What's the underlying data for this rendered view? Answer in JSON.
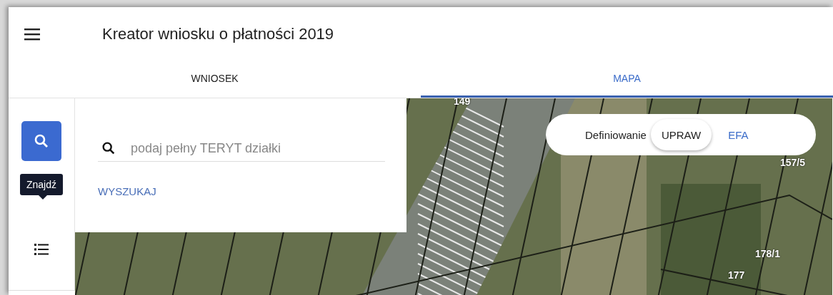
{
  "app_bar": {
    "title": "Kreator wniosku o płatności 2019"
  },
  "tabs": [
    {
      "label": "WNIOSEK",
      "selected": false
    },
    {
      "label": "MAPA",
      "selected": true
    }
  ],
  "rail": {
    "tooltip": "Znajdź",
    "items": [
      {
        "kind": "search",
        "selected": true
      },
      {
        "kind": "list",
        "selected": false
      }
    ]
  },
  "search_panel": {
    "placeholder": "podaj pełny TERYT działki",
    "button": "WYSZUKAJ"
  },
  "mode_switch": {
    "label": "Definiowanie",
    "options": [
      {
        "label": "UPRAW",
        "selected": true
      },
      {
        "label": "EFA",
        "selected": false
      }
    ]
  },
  "map": {
    "parcel_labels": [
      "149",
      "157/5",
      "178/1",
      "177"
    ]
  }
}
